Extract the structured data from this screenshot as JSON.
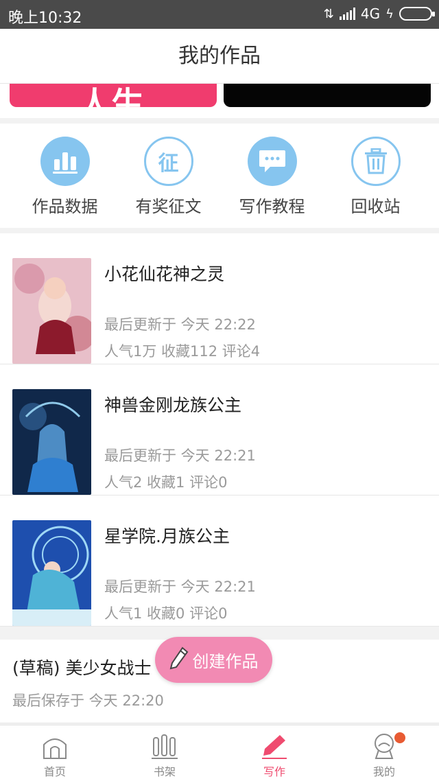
{
  "status_bar": {
    "time": "晚上10:32",
    "network": "4G"
  },
  "header": {
    "title": "我的作品"
  },
  "banner": {
    "left_text": "人生"
  },
  "actions": [
    {
      "label": "作品数据",
      "icon": "bar-chart-icon"
    },
    {
      "label": "有奖征文",
      "icon": "contest-icon"
    },
    {
      "label": "写作教程",
      "icon": "chat-bubble-icon"
    },
    {
      "label": "回收站",
      "icon": "trash-icon"
    }
  ],
  "works": [
    {
      "title": "小花仙花神之灵",
      "updated": "最后更新于 今天 22:22",
      "stats": "人气1万 收藏112 评论4"
    },
    {
      "title": "神兽金刚龙族公主",
      "updated": "最后更新于 今天 22:21",
      "stats": "人气2 收藏1 评论0"
    },
    {
      "title": "星学院.月族公主",
      "updated": "最后更新于 今天 22:21",
      "stats": "人气1 收藏0 评论0"
    }
  ],
  "draft": {
    "title": "(草稿) 美少女战士",
    "saved": "最后保存于 今天 22:20"
  },
  "fab": {
    "label": "创建作品"
  },
  "tabs": [
    {
      "label": "首页",
      "icon": "home-icon"
    },
    {
      "label": "书架",
      "icon": "bookshelf-icon"
    },
    {
      "label": "写作",
      "icon": "pen-icon",
      "active": true
    },
    {
      "label": "我的",
      "icon": "profile-icon",
      "badge": true
    }
  ],
  "colors": {
    "accent": "#ef4b6f",
    "icon_blue": "#86c5ef",
    "fab_pink": "#f28ab3"
  }
}
